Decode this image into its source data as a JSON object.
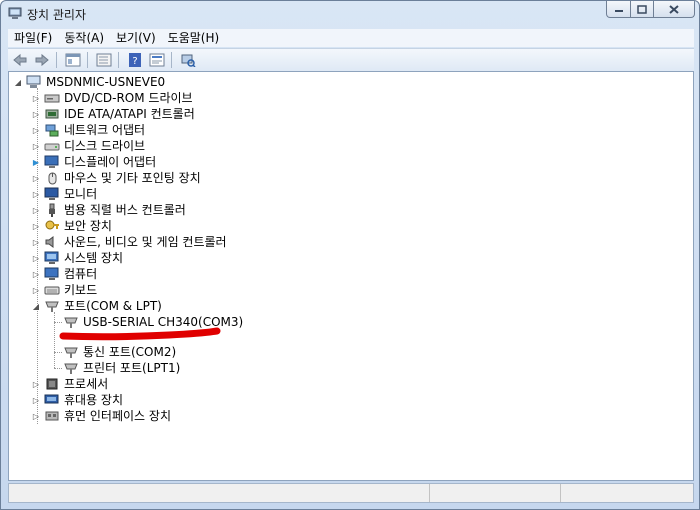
{
  "window": {
    "title": "장치 관리자"
  },
  "menu": {
    "items": [
      "파일(F)",
      "동작(A)",
      "보기(V)",
      "도움말(H)"
    ]
  },
  "toolbar": {
    "buttons": [
      "back-icon",
      "forward-icon",
      "properties-icon",
      "show-hide-tree-icon",
      "help-icon",
      "update-driver-icon",
      "scan-hardware-icon"
    ]
  },
  "tree": {
    "root": "MSDNMIC-USNEVE0",
    "categories": [
      "DVD/CD-ROM 드라이브",
      "IDE ATA/ATAPI 컨트롤러",
      "네트워크 어댑터",
      "디스크 드라이브",
      "디스플레이 어댑터",
      "마우스 및 기타 포인팅 장치",
      "모니터",
      "범용 직렬 버스 컨트롤러",
      "보안 장치",
      "사운드, 비디오 및 게임 컨트롤러",
      "시스템 장치",
      "컴퓨터",
      "키보드",
      "포트(COM & LPT)",
      "프로세서",
      "휴대용 장치",
      "휴먼 인터페이스 장치"
    ],
    "ports": [
      "USB-SERIAL CH340(COM3)",
      "통신 포트(COM2)",
      "프린터 포트(LPT1)"
    ]
  },
  "colors": {
    "annotation": "#e00000",
    "selection_arrow": "#2f8fd3"
  }
}
